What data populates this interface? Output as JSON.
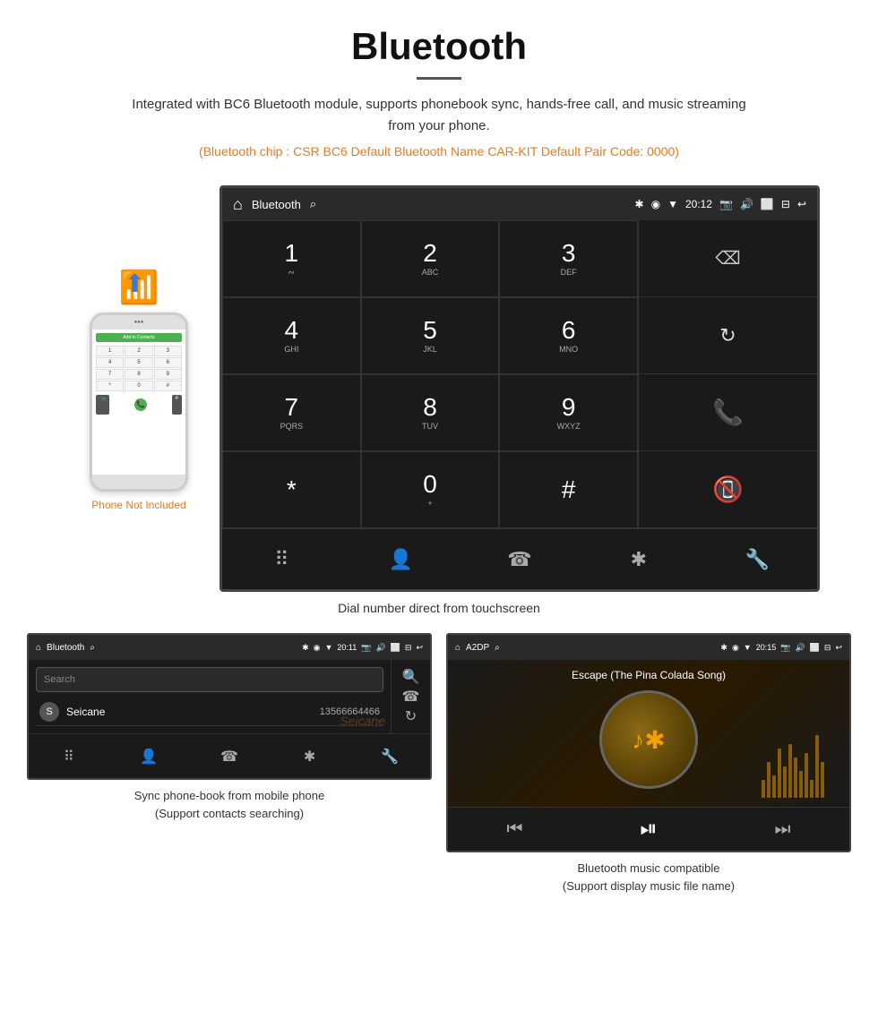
{
  "header": {
    "title": "Bluetooth",
    "description": "Integrated with BC6 Bluetooth module, supports phonebook sync, hands-free call, and music streaming from your phone.",
    "specs": "(Bluetooth chip : CSR BC6   Default Bluetooth Name CAR-KIT    Default Pair Code: 0000)"
  },
  "phone": {
    "label": "Phone Not Included",
    "add_contact": "Add to Contacts"
  },
  "car_screen_main": {
    "status_bar": {
      "app_name": "Bluetooth",
      "time": "20:12"
    },
    "dialpad": {
      "keys": [
        {
          "main": "1",
          "sub": "∾"
        },
        {
          "main": "2",
          "sub": "ABC"
        },
        {
          "main": "3",
          "sub": "DEF"
        },
        {
          "main": "4",
          "sub": "GHI"
        },
        {
          "main": "5",
          "sub": "JKL"
        },
        {
          "main": "6",
          "sub": "MNO"
        },
        {
          "main": "7",
          "sub": "PQRS"
        },
        {
          "main": "8",
          "sub": "TUV"
        },
        {
          "main": "9",
          "sub": "WXYZ"
        },
        {
          "main": "*",
          "sub": ""
        },
        {
          "main": "0",
          "sub": "+"
        },
        {
          "main": "#",
          "sub": ""
        }
      ]
    }
  },
  "caption_main": "Dial number direct from touchscreen",
  "phonebook_screen": {
    "status_bar": {
      "app_name": "Bluetooth",
      "time": "20:11"
    },
    "search_placeholder": "Search",
    "contacts": [
      {
        "initial": "S",
        "name": "Seicane",
        "number": "13566664466"
      }
    ]
  },
  "music_screen": {
    "status_bar": {
      "app_name": "A2DP",
      "time": "20:15"
    },
    "song_title": "Escape (The Pina Colada Song)"
  },
  "caption_phonebook": {
    "line1": "Sync phone-book from mobile phone",
    "line2": "(Support contacts searching)"
  },
  "caption_music": {
    "line1": "Bluetooth music compatible",
    "line2": "(Support display music file name)"
  }
}
